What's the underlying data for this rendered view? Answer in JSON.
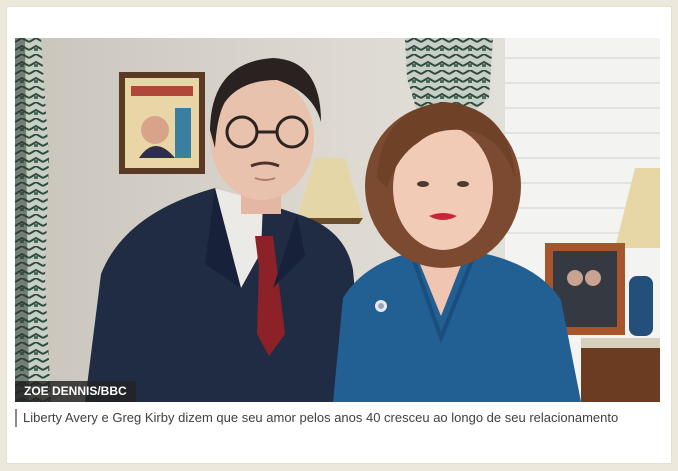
{
  "figure": {
    "image_alt": "Liberty Avery e Greg Kirby",
    "credit": "ZOE DENNIS/BBC",
    "caption": "Liberty Avery e Greg Kirby dizem que seu amor pelos anos 40 cresceu ao longo de seu relacionamento"
  },
  "colors": {
    "page_background": "#ece8db",
    "card_background": "#ffffff",
    "credit_background": "#222222",
    "caption_border": "#8b8b8b",
    "caption_text": "#404040"
  }
}
